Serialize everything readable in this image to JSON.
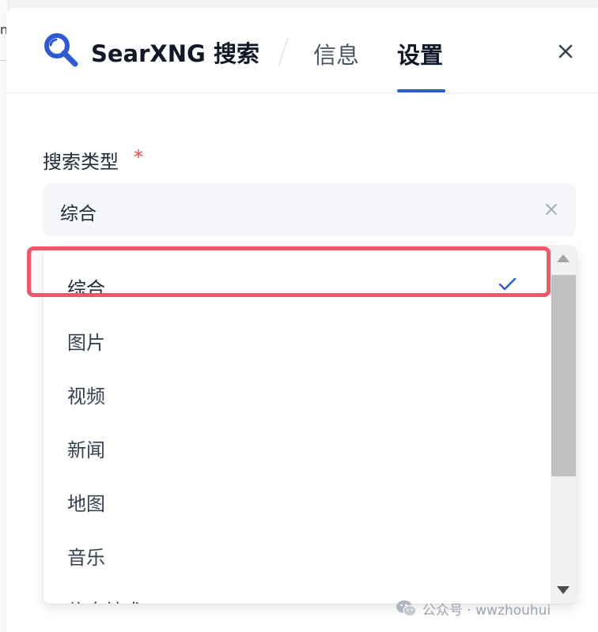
{
  "header": {
    "app_title": "SearXNG 搜索",
    "tabs": [
      {
        "label": "信息",
        "active": false
      },
      {
        "label": "设置",
        "active": true
      }
    ],
    "logo_icon": "search-icon",
    "close_icon": "close-icon"
  },
  "form": {
    "field_label": "搜索类型",
    "required_mark": "*",
    "selected_value": "综合"
  },
  "dropdown": {
    "options": [
      {
        "label": "综合",
        "selected": true
      },
      {
        "label": "图片",
        "selected": false
      },
      {
        "label": "视频",
        "selected": false
      },
      {
        "label": "新闻",
        "selected": false
      },
      {
        "label": "地图",
        "selected": false
      },
      {
        "label": "音乐",
        "selected": false
      },
      {
        "label": "信息技术",
        "selected": false
      }
    ]
  },
  "watermark": {
    "text": "公众号 · wwzhouhui",
    "icon": "wechat-icon"
  },
  "colors": {
    "accent": "#2d5bd7",
    "highlight": "#f2566a",
    "required": "#e5484d"
  }
}
